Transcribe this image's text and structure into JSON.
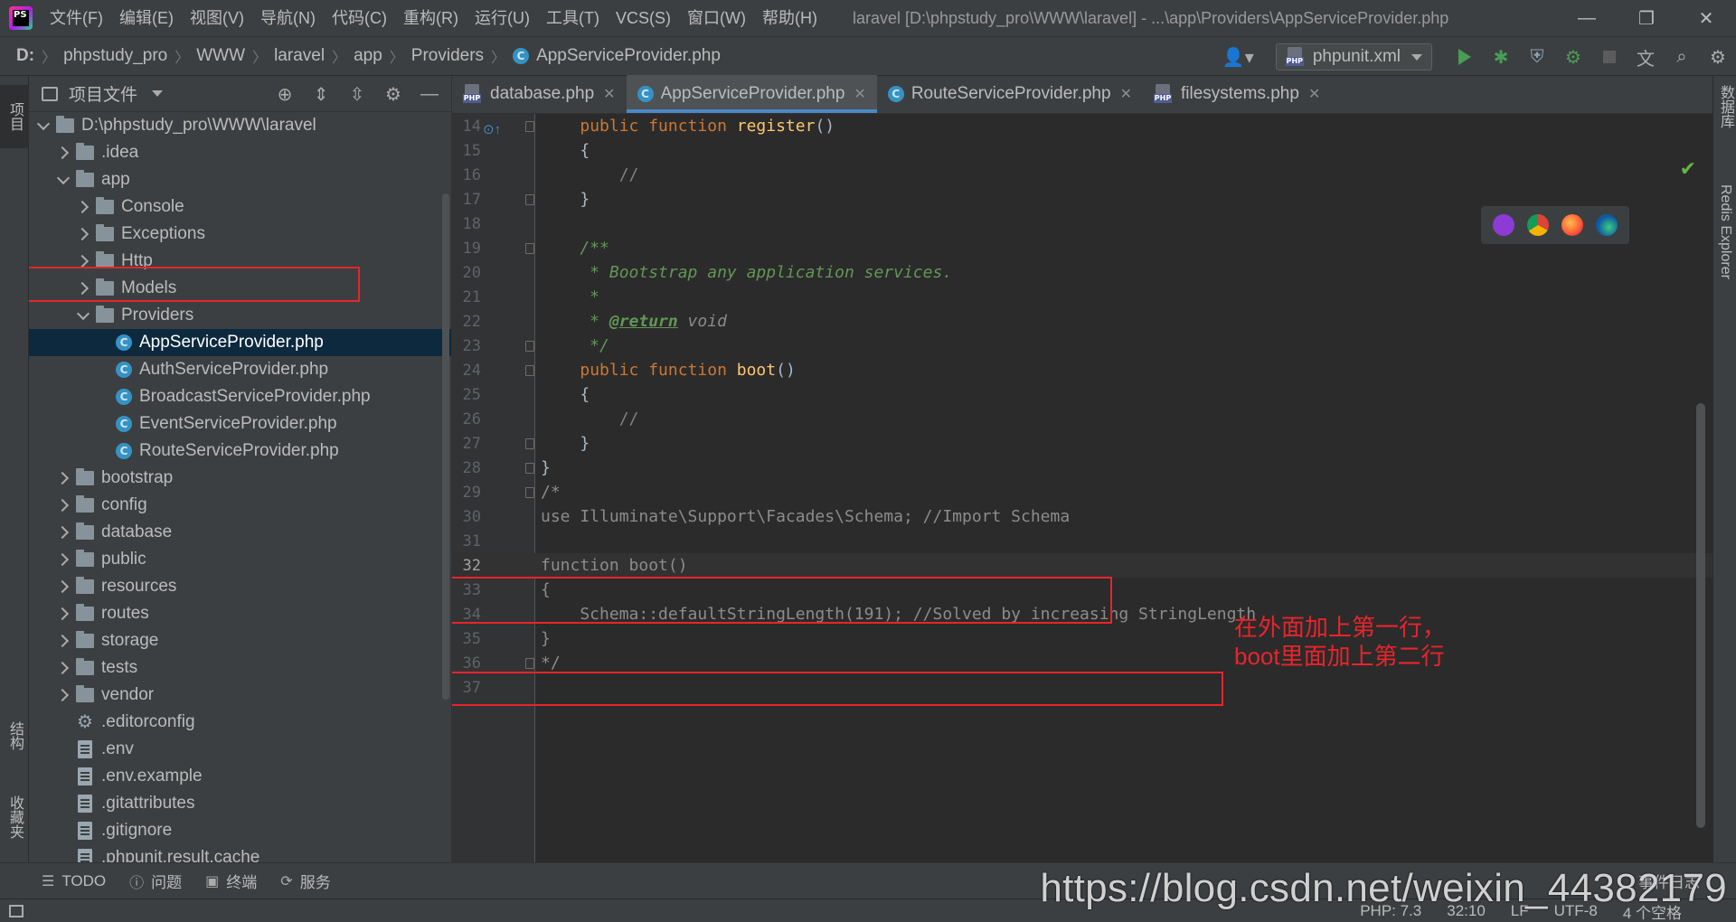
{
  "app": {
    "logo_text": "PS",
    "menu": [
      "文件(F)",
      "编辑(E)",
      "视图(V)",
      "导航(N)",
      "代码(C)",
      "重构(R)",
      "运行(U)",
      "工具(T)",
      "VCS(S)",
      "窗口(W)",
      "帮助(H)"
    ],
    "window_title": "laravel [D:\\phpstudy_pro\\WWW\\laravel] - ...\\app\\Providers\\AppServiceProvider.php",
    "window_controls": [
      "—",
      "❐",
      "✕"
    ]
  },
  "breadcrumb": [
    "D:",
    "phpstudy_pro",
    "WWW",
    "laravel",
    "app",
    "Providers",
    "AppServiceProvider.php"
  ],
  "run_config": {
    "label": "phpunit.xml",
    "icon": "php-file-icon"
  },
  "left_strip": {
    "project_tab": "项目",
    "structure_tab": "结构",
    "favorites_tab": "收藏夹"
  },
  "project_panel": {
    "title": "项目文件",
    "tree": [
      {
        "label": "D:\\phpstudy_pro\\WWW\\laravel",
        "depth": 0,
        "type": "folder",
        "expanded": true
      },
      {
        "label": ".idea",
        "depth": 1,
        "type": "folder",
        "expanded": false
      },
      {
        "label": "app",
        "depth": 1,
        "type": "folder",
        "expanded": true
      },
      {
        "label": "Console",
        "depth": 2,
        "type": "folder",
        "expanded": false
      },
      {
        "label": "Exceptions",
        "depth": 2,
        "type": "folder",
        "expanded": false
      },
      {
        "label": "Http",
        "depth": 2,
        "type": "folder",
        "expanded": false
      },
      {
        "label": "Models",
        "depth": 2,
        "type": "folder",
        "expanded": false
      },
      {
        "label": "Providers",
        "depth": 2,
        "type": "folder",
        "expanded": true
      },
      {
        "label": "AppServiceProvider.php",
        "depth": 3,
        "type": "class",
        "selected": true
      },
      {
        "label": "AuthServiceProvider.php",
        "depth": 3,
        "type": "class"
      },
      {
        "label": "BroadcastServiceProvider.php",
        "depth": 3,
        "type": "class"
      },
      {
        "label": "EventServiceProvider.php",
        "depth": 3,
        "type": "class"
      },
      {
        "label": "RouteServiceProvider.php",
        "depth": 3,
        "type": "class"
      },
      {
        "label": "bootstrap",
        "depth": 1,
        "type": "folder",
        "expanded": false
      },
      {
        "label": "config",
        "depth": 1,
        "type": "folder",
        "expanded": false
      },
      {
        "label": "database",
        "depth": 1,
        "type": "folder",
        "expanded": false
      },
      {
        "label": "public",
        "depth": 1,
        "type": "folder",
        "expanded": false
      },
      {
        "label": "resources",
        "depth": 1,
        "type": "folder",
        "expanded": false
      },
      {
        "label": "routes",
        "depth": 1,
        "type": "folder",
        "expanded": false
      },
      {
        "label": "storage",
        "depth": 1,
        "type": "folder",
        "expanded": false
      },
      {
        "label": "tests",
        "depth": 1,
        "type": "folder",
        "expanded": false
      },
      {
        "label": "vendor",
        "depth": 1,
        "type": "folder",
        "expanded": false
      },
      {
        "label": ".editorconfig",
        "depth": 1,
        "type": "config"
      },
      {
        "label": ".env",
        "depth": 1,
        "type": "file"
      },
      {
        "label": ".env.example",
        "depth": 1,
        "type": "file"
      },
      {
        "label": ".gitattributes",
        "depth": 1,
        "type": "file"
      },
      {
        "label": ".gitignore",
        "depth": 1,
        "type": "file"
      },
      {
        "label": ".phpunit.result.cache",
        "depth": 1,
        "type": "file"
      }
    ]
  },
  "tabs": [
    {
      "label": "database.php",
      "icon": "php-file-icon",
      "active": false
    },
    {
      "label": "AppServiceProvider.php",
      "icon": "class-icon",
      "active": true
    },
    {
      "label": "RouteServiceProvider.php",
      "icon": "class-icon",
      "active": false
    },
    {
      "label": "filesystems.php",
      "icon": "php-file-icon",
      "active": false
    }
  ],
  "code": {
    "current_line": 32,
    "lines": [
      {
        "n": 14,
        "tokens": [
          [
            "",
            "    "
          ],
          [
            "kw",
            "public function "
          ],
          [
            "fn",
            "register"
          ],
          [
            "",
            "()"
          ]
        ]
      },
      {
        "n": 15,
        "tokens": [
          [
            "",
            "    {"
          ]
        ]
      },
      {
        "n": 16,
        "tokens": [
          [
            "cmt",
            "        //"
          ]
        ]
      },
      {
        "n": 17,
        "tokens": [
          [
            "",
            "    }"
          ]
        ]
      },
      {
        "n": 18,
        "tokens": []
      },
      {
        "n": 19,
        "tokens": [
          [
            "doc",
            "    /**"
          ]
        ]
      },
      {
        "n": 20,
        "tokens": [
          [
            "doc",
            "     * Bootstrap any application services."
          ]
        ]
      },
      {
        "n": 21,
        "tokens": [
          [
            "doc",
            "     *"
          ]
        ]
      },
      {
        "n": 22,
        "tokens": [
          [
            "doc",
            "     * "
          ],
          [
            "doctag",
            "@return"
          ],
          [
            "doctype",
            " void"
          ]
        ]
      },
      {
        "n": 23,
        "tokens": [
          [
            "doc",
            "     */"
          ]
        ]
      },
      {
        "n": 24,
        "tokens": [
          [
            "",
            "    "
          ],
          [
            "kw",
            "public function "
          ],
          [
            "fn",
            "boot"
          ],
          [
            "",
            "()"
          ]
        ]
      },
      {
        "n": 25,
        "tokens": [
          [
            "",
            "    {"
          ]
        ]
      },
      {
        "n": 26,
        "tokens": [
          [
            "cmt",
            "        //"
          ]
        ]
      },
      {
        "n": 27,
        "tokens": [
          [
            "",
            "    }"
          ]
        ]
      },
      {
        "n": 28,
        "tokens": [
          [
            "",
            "}"
          ]
        ]
      },
      {
        "n": 29,
        "tokens": [
          [
            "muted",
            "/*"
          ]
        ]
      },
      {
        "n": 30,
        "tokens": [
          [
            "muted",
            "use Illuminate\\Support\\Facades\\Schema; //Import Schema"
          ]
        ]
      },
      {
        "n": 31,
        "tokens": []
      },
      {
        "n": 32,
        "tokens": [
          [
            "muted",
            "function boot()"
          ]
        ]
      },
      {
        "n": 33,
        "tokens": [
          [
            "muted",
            "{"
          ]
        ]
      },
      {
        "n": 34,
        "tokens": [
          [
            "muted",
            "    Schema::defaultStringLength(191); //Solved by increasing StringLength"
          ]
        ]
      },
      {
        "n": 35,
        "tokens": [
          [
            "muted",
            "}"
          ]
        ]
      },
      {
        "n": 36,
        "tokens": [
          [
            "muted",
            "*/"
          ]
        ]
      },
      {
        "n": 37,
        "tokens": []
      }
    ]
  },
  "annotation": {
    "line1": "在外面加上第一行，",
    "line2": "boot里面加上第二行"
  },
  "right_strip": {
    "database_tab": "数据库",
    "redis_tab": "Redis Explorer"
  },
  "bottom_tools": [
    {
      "label": "TODO",
      "icon": "list-icon"
    },
    {
      "label": "问题",
      "icon": "info-icon"
    },
    {
      "label": "终端",
      "icon": "terminal-icon"
    },
    {
      "label": "服务",
      "icon": "services-icon"
    }
  ],
  "event_log": "事件日志",
  "status": {
    "php": "PHP: 7.3",
    "position": "32:10",
    "line_sep": "LF",
    "encoding": "UTF-8",
    "indent": "4 个空格"
  },
  "watermark": "https://blog.csdn.net/weixin_44382179",
  "colors": {
    "accent": "#4a88c7",
    "annotation_red": "#e8242b",
    "run_green": "#499c54"
  }
}
